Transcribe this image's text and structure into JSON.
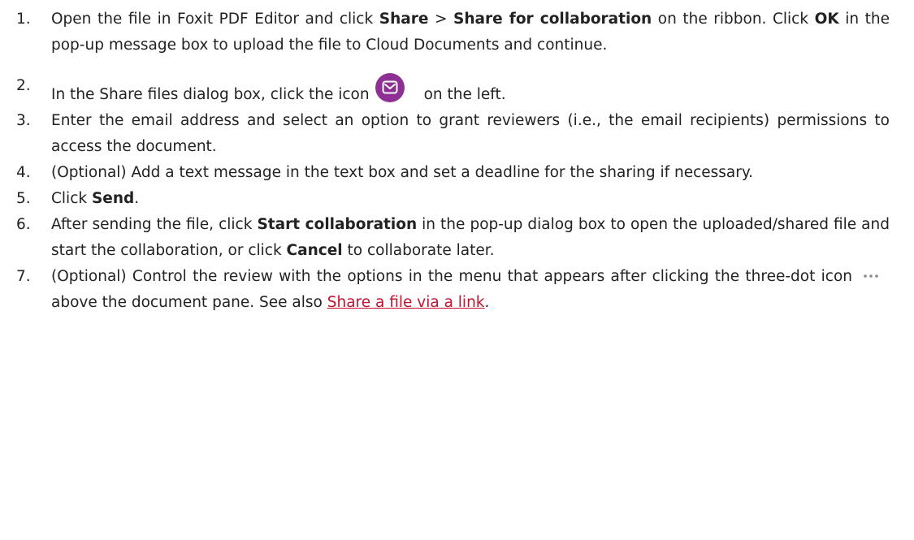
{
  "steps": [
    {
      "number": "1.",
      "parts": [
        "Open the file in Foxit PDF Editor and click ",
        "Share",
        " > ",
        "Share for collaboration",
        " on the ribbon. Click ",
        "OK",
        " in the pop-up message box to upload the file to Cloud Documents and continue."
      ]
    },
    {
      "number": "2.",
      "before_icon": "In the Share files dialog box, click the icon",
      "icon": "mail-icon",
      "after_icon": "on the left."
    },
    {
      "number": "3.",
      "text": "Enter the email address and select an option to grant reviewers (i.e., the email recipients) permissions to access the document."
    },
    {
      "number": "4.",
      "text": "(Optional) Add a text message in the text box and set a deadline for the sharing if necessary."
    },
    {
      "number": "5.",
      "parts": [
        "Click ",
        "Send",
        "."
      ]
    },
    {
      "number": "6.",
      "parts": [
        "After sending the file, click ",
        "Start collaboration",
        " in the pop-up dialog box to open the uploaded/shared file and start the collaboration, or click ",
        "Cancel",
        " to collaborate later."
      ]
    },
    {
      "number": "7.",
      "before_icon": "(Optional) Control the review with the options in the menu that appears after clicking the three-dot icon",
      "icon": "three-dot-icon",
      "after_icon": "above the document pane. See also",
      "link": "Share a file via a link",
      "end": "."
    }
  ],
  "colors": {
    "mail_icon_bg": "#8e2f94",
    "link": "#c4122f",
    "text": "#222222"
  }
}
